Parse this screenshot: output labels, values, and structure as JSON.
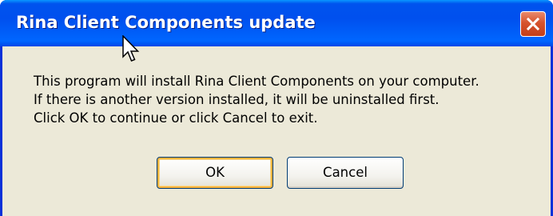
{
  "window": {
    "title": "Rina Client Components update"
  },
  "message": {
    "lines": [
      "This program will install Rina Client Components on your computer.",
      "If there is another version installed, it will be uninstalled first.",
      "Click OK to continue or click Cancel to exit."
    ]
  },
  "buttons": {
    "ok_label": "OK",
    "cancel_label": "Cancel"
  },
  "icons": {
    "close": "close-icon",
    "cursor": "mouse-cursor-icon"
  },
  "colors": {
    "titlebar": "#0054e3",
    "close_button": "#d6532e",
    "dialog_background": "#ece9d8"
  }
}
